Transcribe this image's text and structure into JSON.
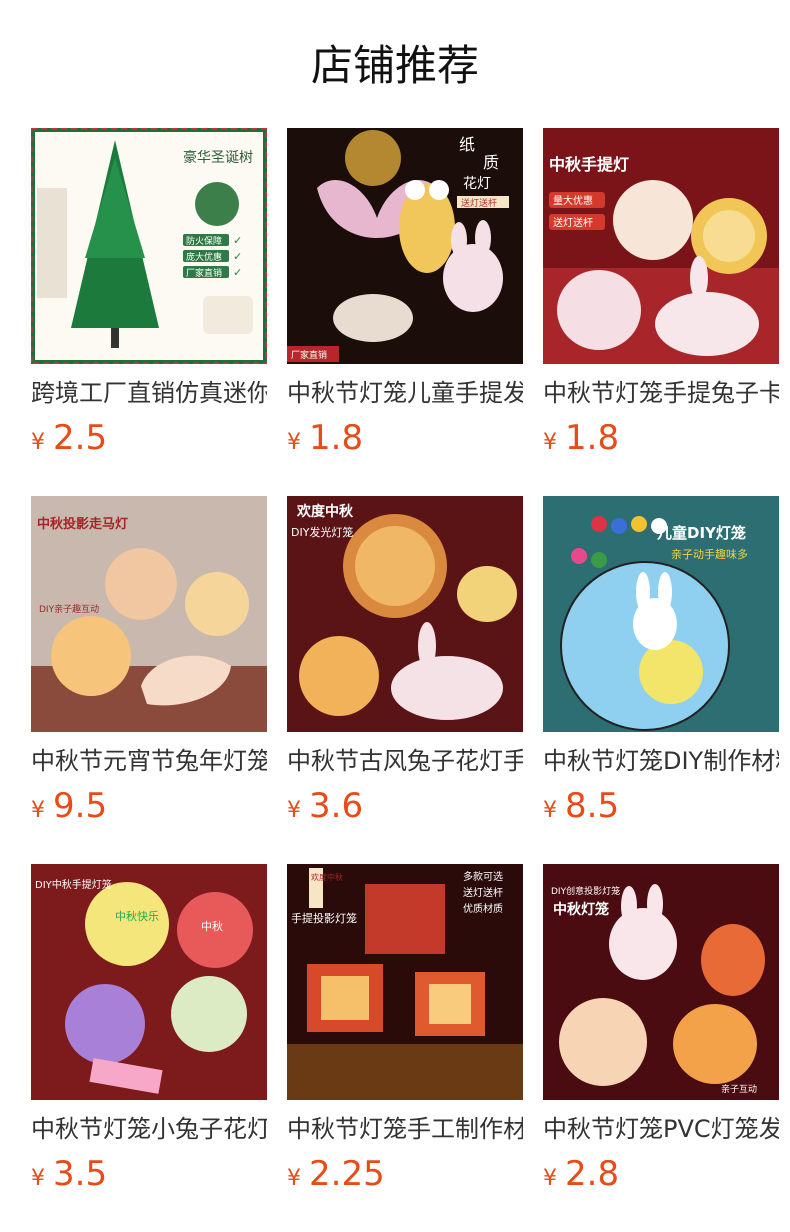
{
  "section": {
    "title": "店铺推荐"
  },
  "products": [
    {
      "name": "跨境工厂直销仿真迷你圣诞树",
      "currency": "¥",
      "price": "2.5",
      "image_text": [
        "豪华圣诞树",
        "防火保障",
        "庞大优惠",
        "厂家直销"
      ]
    },
    {
      "name": "中秋节灯笼儿童手提发光",
      "currency": "¥",
      "price": "1.8",
      "image_text": [
        "纸",
        "质",
        "花灯",
        "送灯送杆",
        "厂家直销"
      ]
    },
    {
      "name": "中秋节灯笼手提兔子卡通",
      "currency": "¥",
      "price": "1.8",
      "image_text": [
        "中秋手提灯",
        "量大优惠",
        "送灯送杆"
      ]
    },
    {
      "name": "中秋节元宵节兔年灯笼手工",
      "currency": "¥",
      "price": "9.5",
      "image_text": [
        "中秋投影走马灯",
        "DIY亲子趣互动"
      ]
    },
    {
      "name": "中秋节古风兔子花灯手提",
      "currency": "¥",
      "price": "3.6",
      "image_text": [
        "欢度中秋",
        "DIY发光灯笼"
      ]
    },
    {
      "name": "中秋节灯笼DIY制作材料包",
      "currency": "¥",
      "price": "8.5",
      "image_text": [
        "儿童DIY灯笼",
        "亲子动手趣味多"
      ]
    },
    {
      "name": "中秋节灯笼小兔子花灯手提",
      "currency": "¥",
      "price": "3.5",
      "image_text": [
        "DIY中秋手提灯笼",
        "中秋快乐",
        "中秋"
      ]
    },
    {
      "name": "中秋节灯笼手工制作材料",
      "currency": "¥",
      "price": "2.25",
      "image_text": [
        "欢度中秋",
        "手提投影灯笼",
        "多款可选",
        "送灯送杆",
        "优质材质"
      ]
    },
    {
      "name": "中秋节灯笼PVC灯笼发光",
      "currency": "¥",
      "price": "2.8",
      "image_text": [
        "DIY创意投影灯笼",
        "中秋灯笼",
        "亲子互动"
      ]
    }
  ],
  "colors": {
    "price": "#e94b16",
    "title": "#111111"
  }
}
